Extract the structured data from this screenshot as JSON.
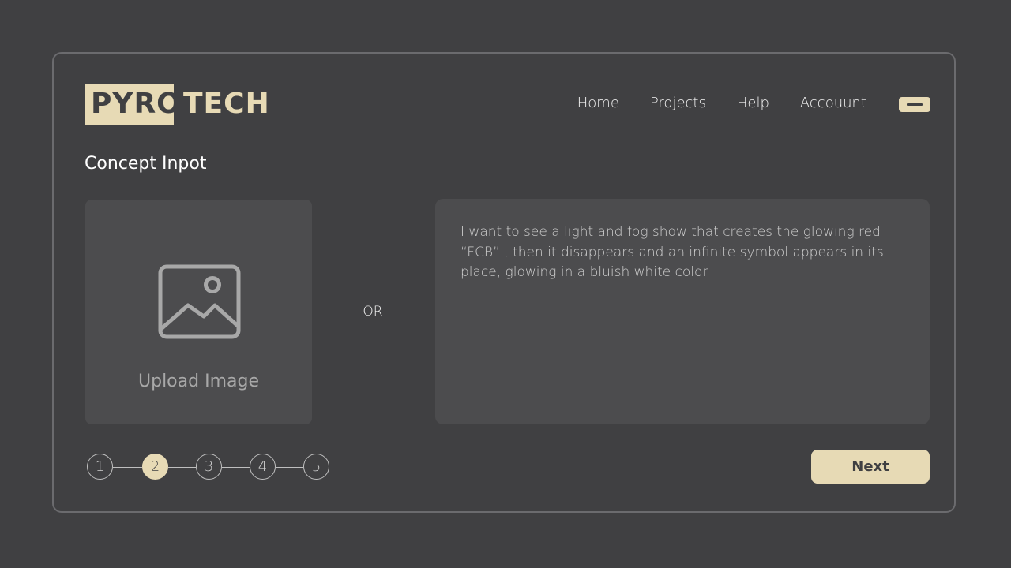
{
  "brand": {
    "logo_left": "PYRO",
    "logo_right": "TECH"
  },
  "nav": {
    "items": [
      {
        "label": "Home"
      },
      {
        "label": "Projects"
      },
      {
        "label": "Help"
      },
      {
        "label": "Accouunt"
      }
    ],
    "menu_icon": "minus-icon"
  },
  "main": {
    "title": "Concept Inpot",
    "upload": {
      "label": "Upload Image",
      "icon": "image-icon"
    },
    "or_label": "OR",
    "concept_text": "I want to see a light and fog show that creates the glowing red “FCB” , then it disappears and an infinite symbol appears in its place, glowing in a bluish white color"
  },
  "stepper": {
    "steps": [
      "1",
      "2",
      "3",
      "4",
      "5"
    ],
    "active_step": 2
  },
  "actions": {
    "next_label": "Next"
  },
  "colors": {
    "background": "#404042",
    "accent": "#e7dab5",
    "panel": "#4c4c4e",
    "frame_border": "#6b6b6e"
  }
}
